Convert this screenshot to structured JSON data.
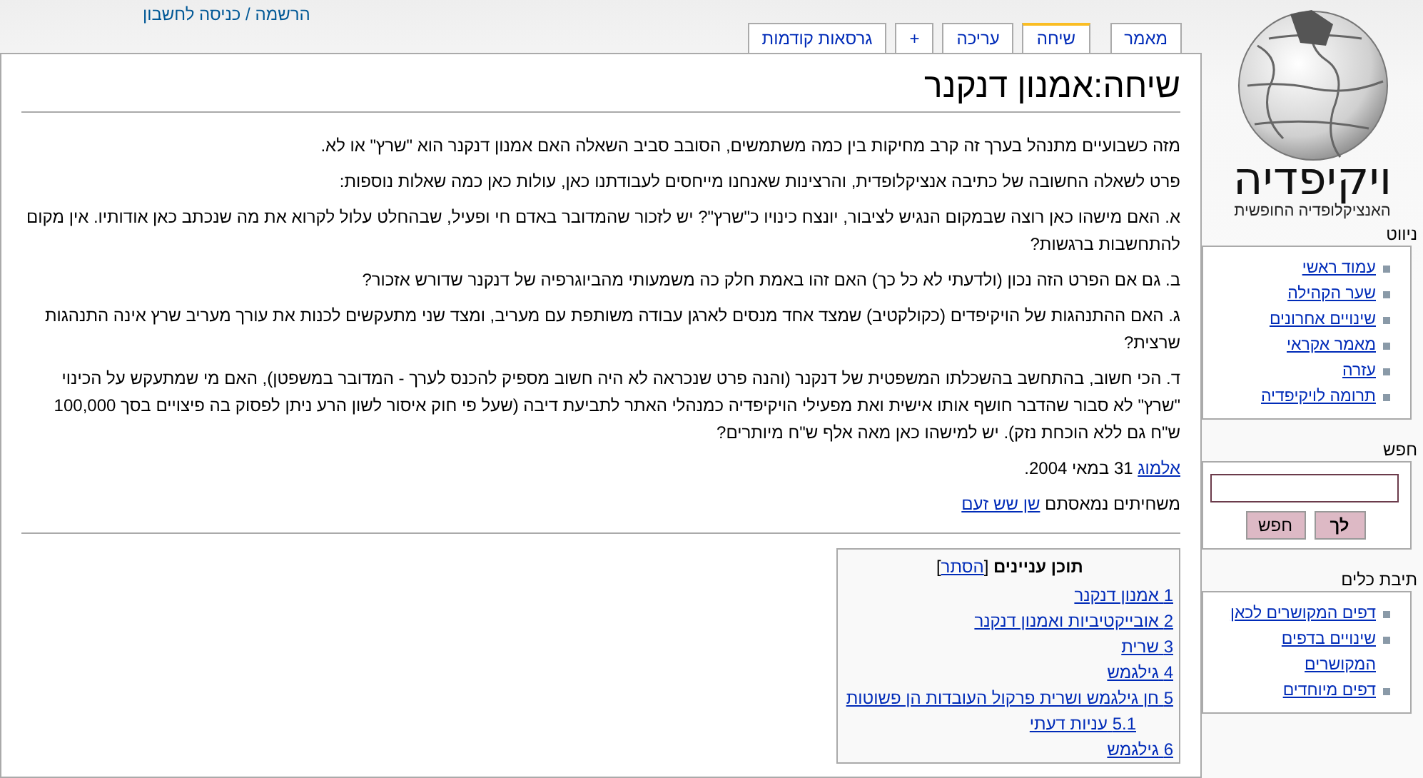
{
  "personal_links": "הרשמה / כניסה לחשבון",
  "tabs": [
    {
      "label": "מאמר",
      "selected": false
    },
    {
      "label": "שיחה",
      "selected": true
    },
    {
      "label": "עריכה",
      "selected": false
    },
    {
      "label": "+",
      "selected": false
    },
    {
      "label": "גרסאות קודמות",
      "selected": false
    }
  ],
  "logo": {
    "title": "ויקיפדיה",
    "tagline": "האנציקלופדיה החופשית"
  },
  "sidebar": {
    "navigation": {
      "heading": "ניווט",
      "items": [
        "עמוד ראשי",
        "שער הקהילה",
        "שינויים אחרונים",
        "מאמר אקראי",
        "עזרה",
        "תרומה לויקיפדיה"
      ]
    },
    "search": {
      "heading": "חפש",
      "buttons": [
        "לך",
        "חפש"
      ]
    },
    "toolbox": {
      "heading": "תיבת כלים",
      "items": [
        "דפים המקושרים לכאן",
        "שינויים בדפים המקושרים",
        "דפים מיוחדים"
      ]
    }
  },
  "page": {
    "title": "שיחה:אמנון דנקנר",
    "paragraphs": [
      [
        {
          "kind": "text",
          "text": "מזה כשבועיים מתנהל בערך זה קרב מחיקות בין כמה משתמשים, הסובב סביב השאלה האם אמנון דנקנר הוא \"שרץ\" או לא."
        }
      ],
      [
        {
          "kind": "text",
          "text": "פרט לשאלה החשובה של כתיבה אנציקלופדית, והרצינות שאנחנו מייחסים לעבודתנו כאן, עולות כאן כמה שאלות נוספות:"
        }
      ],
      [
        {
          "kind": "text",
          "text": "א. האם מישהו כאן רוצה שבמקום הנגיש לציבור, יונצח כינויו כ\"שרץ\"? יש לזכור שהמדובר באדם חי ופעיל, שבהחלט עלול לקרוא את מה שנכתב כאן אודותיו. אין מקום להתחשבות ברגשות?"
        }
      ],
      [
        {
          "kind": "text",
          "text": "ב. גם אם הפרט הזה נכון (ולדעתי לא כל כך) האם זהו באמת חלק כה משמעותי מהביוגרפיה של דנקנר שדורש אזכור?"
        }
      ],
      [
        {
          "kind": "text",
          "text": "ג. האם ההתנהגות של הויקיפדים (כקולקטיב) שמצד אחד מנסים לארגן עבודה משותפת עם מעריב, ומצד שני מתעקשים לכנות את עורך מעריב שרץ אינה התנהגות שרצית?"
        }
      ],
      [
        {
          "kind": "text",
          "text": "ד. הכי חשוב, בהתחשב בהשכלתו המשפטית של דנקנר (והנה פרט שנכראה לא היה חשוב מספיק להכנס לערך - המדובר במשפטן), האם מי שמתעקש על הכינוי \"שרץ\" לא סבור שהדבר חושף אותו אישית ואת מפעילי הויקיפדיה כמנהלי האתר לתביעת דיבה (שעל פי חוק איסור לשון הרע ניתן לפסוק בה פיצויים בסך 100,000 ש\"ח גם ללא הוכחת נזק). יש למישהו כאן מאה אלף ש\"ח מיותרים?"
        }
      ],
      [
        {
          "kind": "link",
          "text": "אלמוג"
        },
        {
          "kind": "text",
          "text": " 31 במאי 2004."
        }
      ],
      [
        {
          "kind": "text",
          "text": "משחיתים נמאסתם "
        },
        {
          "kind": "link",
          "text": "שן שש זעם"
        }
      ]
    ],
    "toc": {
      "title": "תוכן עניינים",
      "bracket_open": "[",
      "hide_link": "הסתר",
      "bracket_close": "]",
      "entries": [
        {
          "number": "1",
          "text": "אמנון דנקנר"
        },
        {
          "number": "2",
          "text": "אובייקטיביות ואמנון דנקנר"
        },
        {
          "number": "3",
          "text": "שרית"
        },
        {
          "number": "4",
          "text": "גילגמש"
        },
        {
          "number": "5",
          "text": "חן גילגמש ושרית פרקול העובדות הן פשוטות",
          "children": [
            {
              "number": "5.1",
              "text": "עניות דעתי"
            }
          ]
        },
        {
          "number": "6",
          "text": "גילגמש"
        }
      ]
    }
  }
}
